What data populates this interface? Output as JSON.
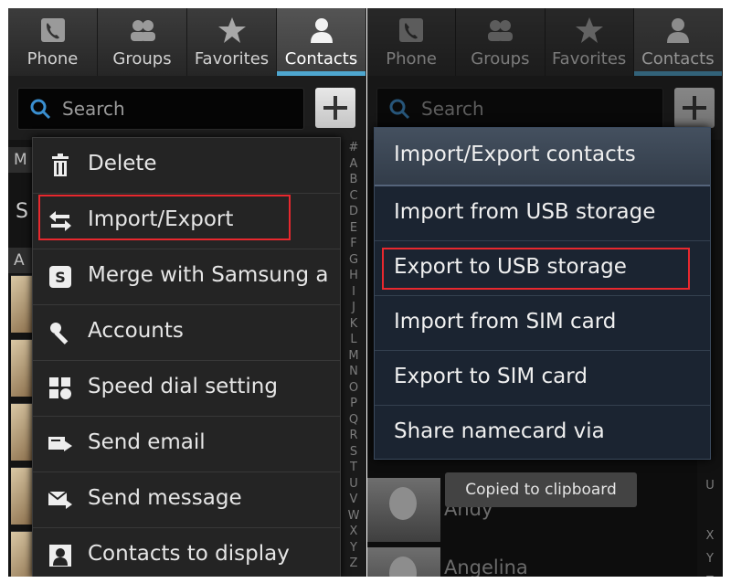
{
  "left_panel": {
    "tabs": [
      {
        "label": "Phone",
        "icon": "phone-icon"
      },
      {
        "label": "Groups",
        "icon": "groups-icon"
      },
      {
        "label": "Favorites",
        "icon": "star-icon"
      },
      {
        "label": "Contacts",
        "icon": "contacts-icon",
        "active": true
      }
    ],
    "search": {
      "placeholder": "Search"
    },
    "list_fragments": {
      "header_1": "M",
      "row_letter": "S",
      "header_2": "A"
    },
    "alphabet": [
      "#",
      "A",
      "B",
      "C",
      "D",
      "E",
      "F",
      "G",
      "H",
      "I",
      "J",
      "K",
      "L",
      "M",
      "N",
      "O",
      "P",
      "Q",
      "R",
      "S",
      "T",
      "U",
      "V",
      "W",
      "X",
      "Y",
      "Z"
    ],
    "menu": [
      {
        "label": "Delete",
        "icon": "trash-icon"
      },
      {
        "label": "Import/Export",
        "icon": "import-export-icon",
        "highlighted": true
      },
      {
        "label": "Merge with Samsung a",
        "icon": "samsung-account-icon"
      },
      {
        "label": "Accounts",
        "icon": "key-icon"
      },
      {
        "label": "Speed dial setting",
        "icon": "speed-dial-icon"
      },
      {
        "label": "Send email",
        "icon": "send-email-icon"
      },
      {
        "label": "Send message",
        "icon": "send-message-icon"
      },
      {
        "label": "Contacts to display",
        "icon": "contacts-display-icon"
      }
    ]
  },
  "right_panel": {
    "tabs": [
      {
        "label": "Phone",
        "icon": "phone-icon"
      },
      {
        "label": "Groups",
        "icon": "groups-icon"
      },
      {
        "label": "Favorites",
        "icon": "star-icon"
      },
      {
        "label": "Contacts",
        "icon": "contacts-icon",
        "active": true
      }
    ],
    "search": {
      "placeholder": "Search"
    },
    "dialog": {
      "title": "Import/Export contacts",
      "items": [
        {
          "label": "Import from USB storage"
        },
        {
          "label": "Export to USB storage",
          "highlighted": true
        },
        {
          "label": "Import from SIM card"
        },
        {
          "label": "Export to SIM card"
        },
        {
          "label": "Share namecard via"
        }
      ]
    },
    "contacts_below": [
      "Andy",
      "Angelina"
    ],
    "toast": "Copied to clipboard",
    "alphabet_fragments": [
      "U",
      "X",
      "Y",
      "Z"
    ]
  },
  "colors": {
    "highlight_red": "#e8282e",
    "active_tab_underline": "#4ea6cf",
    "dialog_bg": "#1b2431"
  }
}
